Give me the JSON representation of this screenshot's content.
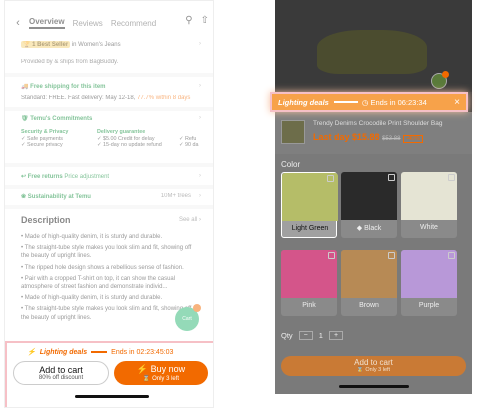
{
  "left": {
    "nav": {
      "back": "‹",
      "tabs": [
        "Overview",
        "Reviews",
        "Recommend"
      ],
      "active": "Overview"
    },
    "best_seller": {
      "badge": "1 Best Seller",
      "text": "in Women's Jeans"
    },
    "provided_by": "Provided by & ships from BagBuddy.",
    "shipping": {
      "title": "Free shipping for this item",
      "detail": "Standard: FREE. Fast delivery: May 12-18,",
      "detail_orange": "77.7% within 8 days"
    },
    "commitments": {
      "title": "Temu's Commitments",
      "col1_head": "Security & Privacy",
      "col1_items": [
        "✓ Safe payments",
        "✓ Secure privacy"
      ],
      "col2_head": "Delivery guarantee",
      "col2_items": [
        "✓ $5.00 Credit for delay",
        "✓ 15-day no update refund"
      ],
      "col3_items": [
        "✓ Refu",
        "✓ 90 da"
      ]
    },
    "returns": {
      "title": "Free returns",
      "sub": "Price adjustment"
    },
    "sustainability": {
      "title": "Sustainability at Temu",
      "trees": "10M+ trees"
    },
    "description": {
      "title": "Description",
      "see_all": "See all",
      "bullets": [
        "Made of high-quality denim, it is sturdy and durable.",
        "The straight-tube style makes you look slim and fit, showing off the beauty of upright lines.",
        "The ripped hole design shows a rebellious sense of fashion.",
        "Pair with a cropped T-shirt on top, it can show the casual atmosphere of street fashion and demonstrate individ...",
        "Made of high-quality denim, it is sturdy and durable.",
        "The straight-tube style makes you look slim and fit, showing off the beauty of upright lines."
      ]
    },
    "bottom": {
      "lighting_deals": "Lighting deals",
      "ends": "Ends in 02:23:45:03",
      "add_to_cart": "Add to cart",
      "discount": "80% off discount",
      "buy_now": "Buy now",
      "only_left": "Only 3 left"
    },
    "cart_label": "Cart"
  },
  "right": {
    "deal_banner": {
      "title": "Lighting deals",
      "ends": "Ends in 06:23:34",
      "close": "×"
    },
    "product": {
      "title": "Trendy Denims Crocodile Print Shoulder Bag",
      "price_label": "Last day",
      "price": "$15.88",
      "old_price": "$53.88",
      "pct": "-40%"
    },
    "color_label": "Color",
    "options": [
      {
        "label": "Light Green",
        "color": "#b5bd68"
      },
      {
        "label": "◆ Black",
        "color": "#2a2a2a"
      },
      {
        "label": "White",
        "color": "#e5e4d4"
      },
      {
        "label": "Pink",
        "color": "#d4558a"
      },
      {
        "label": "Brown",
        "color": "#b78a55"
      },
      {
        "label": "Purple",
        "color": "#b898d8"
      }
    ],
    "qty_label": "Qty",
    "qty_minus": "−",
    "qty_value": "1",
    "qty_plus": "+",
    "add_to_cart": "Add to cart",
    "only_left": "Only 3 left"
  }
}
